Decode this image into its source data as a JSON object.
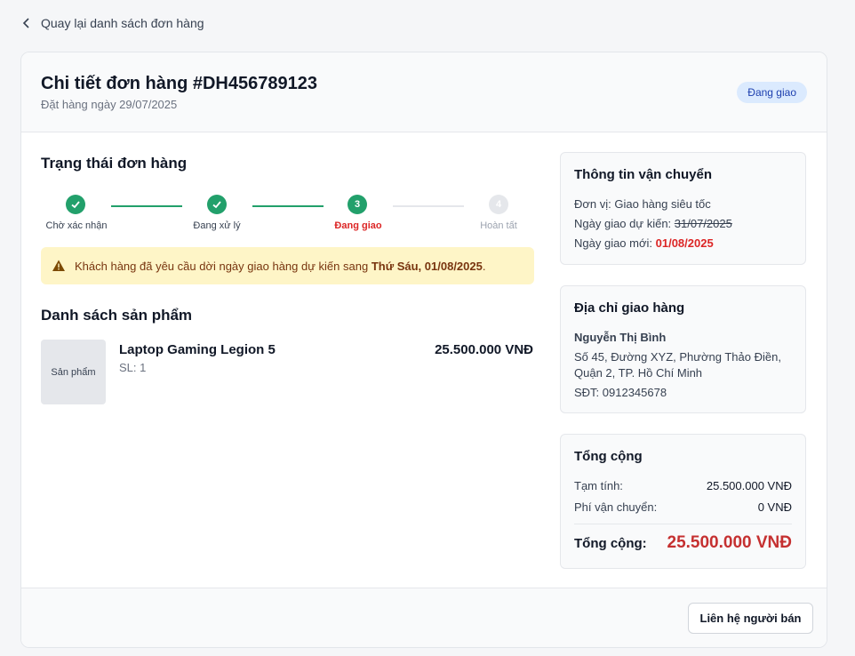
{
  "nav": {
    "back_label": "Quay lại danh sách đơn hàng"
  },
  "order": {
    "title": "Chi tiết đơn hàng #DH456789123",
    "date": "Đặt hàng ngày 29/07/2025",
    "status": "Đang giao"
  },
  "progress": {
    "title": "Trạng thái đơn hàng",
    "steps": [
      {
        "number": "1",
        "label": "Chờ xác nhận",
        "state": "done"
      },
      {
        "number": "2",
        "label": "Đang xử lý",
        "state": "done"
      },
      {
        "number": "3",
        "label": "Đang giao",
        "state": "active"
      },
      {
        "number": "4",
        "label": "Hoàn tất",
        "state": "pending"
      }
    ]
  },
  "alert": {
    "prefix": "Khách hàng đã yêu cầu dời ngày giao hàng dự kiến sang ",
    "highlight": "Thứ Sáu, 01/08/2025",
    "suffix": ".",
    "icon": "warning-icon"
  },
  "products": {
    "title": "Danh sách sản phẩm",
    "items": [
      {
        "thumb": "Sản phẩm",
        "name": "Laptop Gaming Legion 5",
        "qty": "SL: 1",
        "price": "25.500.000 VNĐ"
      }
    ]
  },
  "shipping": {
    "title": "Thông tin vận chuyển",
    "unit": "Đơn vị: Giao hàng siêu tốc",
    "expected_label": "Ngày giao dự kiến: ",
    "expected_old": "31/07/2025",
    "new_label": "Ngày giao mới: ",
    "new_date": "01/08/2025"
  },
  "address": {
    "title": "Địa chỉ giao hàng",
    "name": "Nguyễn Thị Bình",
    "line1": "Số 45, Đường XYZ, Phường Thảo Điền,",
    "line2": "Quận 2, TP. Hồ Chí Minh",
    "phone": "SĐT: 0912345678"
  },
  "summary": {
    "title": "Tổng cộng",
    "subtotal_label": "Tạm tính:",
    "subtotal": "25.500.000 VNĐ",
    "shipping_label": "Phí vận chuyển:",
    "shipping": "0 VNĐ",
    "total_label": "Tổng cộng:",
    "total": "25.500.000 VNĐ"
  },
  "footer": {
    "contact_label": "Liên hệ người bán"
  },
  "colors": {
    "green": "#22a06b",
    "red": "#dc2626",
    "alert_bg": "#fef5c7",
    "badge_bg": "#dbeafe"
  }
}
